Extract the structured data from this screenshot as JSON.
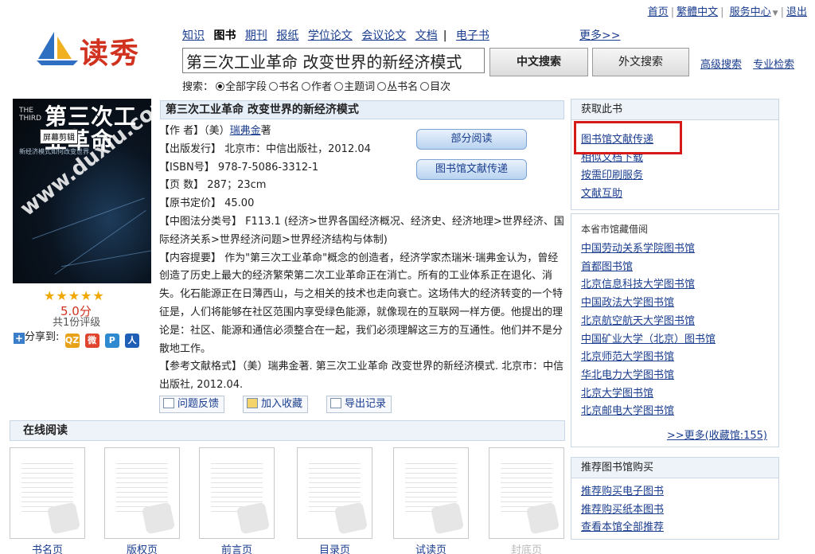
{
  "top_links": [
    "首页",
    "繁體中文",
    "服务中心",
    "退出"
  ],
  "logo_text": "读秀",
  "categories": [
    "知识",
    "图书",
    "期刊",
    "报纸",
    "学位论文",
    "会议论文",
    "文档",
    "电子书"
  ],
  "more_categories": "更多>>",
  "search": {
    "query": "第三次工业革命 改变世界的新经济模式",
    "btn_chinese": "中文搜索",
    "btn_foreign": "外文搜索",
    "advanced": "高级搜索",
    "professional": "专业检索",
    "options_label": "搜索：",
    "options": [
      "全部字段",
      "书名",
      "作者",
      "主题词",
      "丛书名",
      "目次"
    ],
    "selected_option": "全部字段"
  },
  "cover": {
    "the_en": "THE THIRD",
    "title": "第三次工业革命",
    "subtitle": "新经济模式如何改变世界",
    "watermark": "www.duxiu.com",
    "screenshot_tag": "屏幕剪辑"
  },
  "rating": {
    "stars": "★★★★★",
    "score": "5.0分",
    "count": "共1份评级",
    "share_label": "分享到:",
    "share_icons": [
      "QZ",
      "微",
      "P",
      "人"
    ]
  },
  "book": {
    "title": "第三次工业革命 改变世界的新经济模式",
    "author_label": "【作 者】",
    "author_pre": "（美）",
    "author_link": "瑞弗金",
    "author_post": "著",
    "publish": "【出版发行】 北京市：中信出版社，2012.04",
    "isbn": "【ISBN号】 978-7-5086-3312-1",
    "pages": "【页 数】 287；23cm",
    "price": "【原书定价】 45.00",
    "clc": "【中图法分类号】 F113.1 (经济>世界各国经济概况、经济史、经济地理>世界经济、国际经济关系>世界经济问题>世界经济结构与体制)",
    "abstract": "【内容提要】 作为\"第三次工业革命\"概念的创造者，经济学家杰瑞米·瑞弗金认为，曾经创造了历史上最大的经济繁荣第二次工业革命正在消亡。所有的工业体系正在退化、消失。化石能源正在日薄西山，与之相关的技术也走向衰亡。这场伟大的经济转变的一个特征是，人们将能够在社区范围内享受绿色能源，就像现在的互联网一样方便。他提出的理论是：社区、能源和通信必须整合在一起，我们必须理解这三方的互通性。他们并不是分散地工作。",
    "citation": "【参考文献格式】（美）瑞弗金著. 第三次工业革命 改变世界的新经济模式. 北京市：中信出版社, 2012.04."
  },
  "buttons": {
    "partial_read": "部分阅读",
    "doc_delivery": "图书馆文献传递",
    "feedback": "问题反馈",
    "favorite": "加入收藏",
    "export": "导出记录"
  },
  "online_read": {
    "title": "在线阅读",
    "thumbs": [
      "书名页",
      "版权页",
      "前言页",
      "目录页",
      "试读页",
      "封底页"
    ]
  },
  "get_book": {
    "title": "获取此书",
    "links": [
      "图书馆文献传递",
      "相似文档下载",
      "按需印刷服务",
      "文献互助"
    ]
  },
  "libraries": {
    "subtitle": "本省市馆藏借阅",
    "links": [
      "中国劳动关系学院图书馆",
      "首都图书馆",
      "北京信息科技大学图书馆",
      "中国政法大学图书馆",
      "北京航空航天大学图书馆",
      "中国矿业大学（北京）图书馆",
      "北京师范大学图书馆",
      "华北电力大学图书馆",
      "北京大学图书馆",
      "北京邮电大学图书馆"
    ],
    "more": ">>更多(收藏馆:155)"
  },
  "buy": {
    "title": "推荐图书馆购买",
    "links": [
      "推荐购买电子图书",
      "推荐购买纸本图书",
      "查看本馆全部推荐"
    ]
  },
  "colors": {
    "link": "#1a3d8f",
    "highlight_box": "#d61a1a",
    "logo": "#d0321f",
    "star": "#f0a800"
  }
}
